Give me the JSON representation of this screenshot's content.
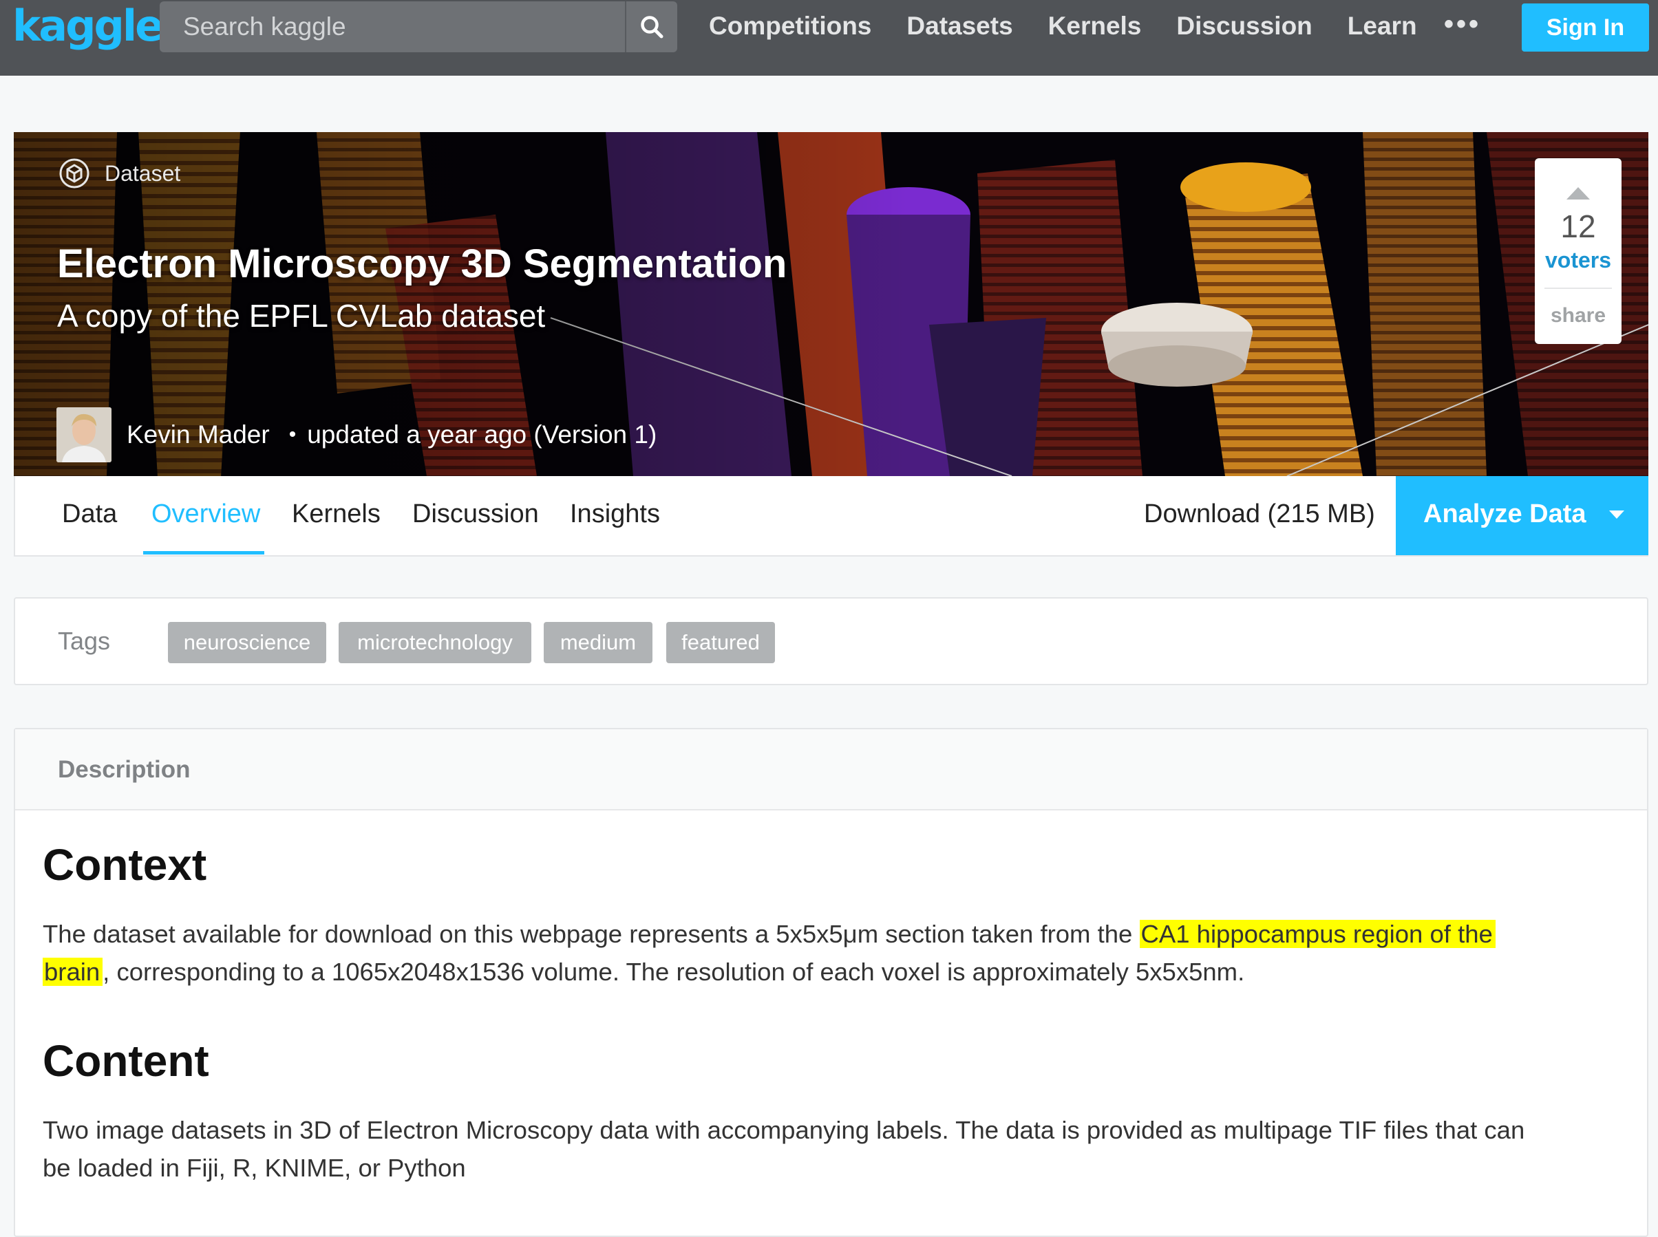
{
  "nav": {
    "logo": "kaggle",
    "search_placeholder": "Search kaggle",
    "links": [
      "Competitions",
      "Datasets",
      "Kernels",
      "Discussion",
      "Learn"
    ],
    "more": "•••",
    "sign_in": "Sign In"
  },
  "hero": {
    "type_label": "Dataset",
    "title": "Electron Microscopy 3D Segmentation",
    "subtitle": "A copy of the EPFL CVLab dataset",
    "author": "Kevin Mader",
    "separator": "•",
    "updated": "updated a year ago (Version 1)",
    "votes": {
      "count": "12",
      "label": "voters",
      "share": "share"
    }
  },
  "tabs": {
    "items": [
      "Data",
      "Overview",
      "Kernels",
      "Discussion",
      "Insights"
    ],
    "active": "Overview",
    "download": "Download (215 MB)",
    "analyze": "Analyze Data"
  },
  "tags": {
    "label": "Tags",
    "items": [
      "neuroscience",
      "microtechnology",
      "medium",
      "featured"
    ]
  },
  "description": {
    "header": "Description",
    "context_heading": "Context",
    "context_line1_before": "The dataset available for download on this webpage represents a 5x5x5μm section taken from the ",
    "context_line1_highlight": "CA1 hippocampus region of the",
    "context_line2_highlight": "brain",
    "context_line2_after": ", corresponding to a 1065x2048x1536 volume. The resolution of each voxel is approximately 5x5x5nm.",
    "content_heading": "Content",
    "content_line1": "Two image datasets in 3D of Electron Microscopy data with accompanying labels. The data is provided as multipage TIF files that can",
    "content_line2": "be loaded in Fiji, R, KNIME, or Python"
  },
  "colors": {
    "nav_bg": "#505357",
    "accent": "#20beff",
    "highlight": "#ffff00",
    "tag_bg": "#b0b3b5"
  }
}
